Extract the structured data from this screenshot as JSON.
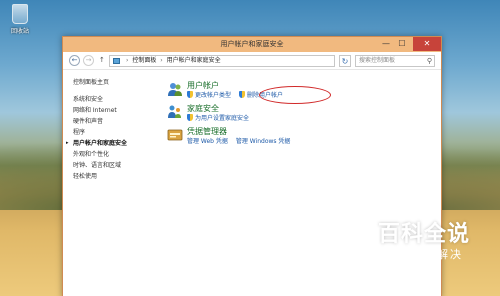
{
  "desktop": {
    "recycle_bin_label": "回收站"
  },
  "window": {
    "title": "用户帐户和家庭安全",
    "controls": {
      "minimize": "—",
      "maximize": "☐",
      "close": "✕"
    }
  },
  "address_bar": {
    "breadcrumb": [
      "控制面板",
      "用户帐户和家庭安全"
    ],
    "separator": "›",
    "search_placeholder": "搜索控制面板"
  },
  "sidebar": {
    "items": [
      {
        "label": "控制面板主页"
      },
      {
        "label": "系统和安全"
      },
      {
        "label": "网络和 Internet"
      },
      {
        "label": "硬件和声音"
      },
      {
        "label": "程序"
      },
      {
        "label": "用户帐户和家庭安全"
      },
      {
        "label": "外观和个性化"
      },
      {
        "label": "时钟、语言和区域"
      },
      {
        "label": "轻松使用"
      }
    ]
  },
  "sections": [
    {
      "title": "用户帐户",
      "links": [
        "更改帐户类型",
        "删除用户帐户"
      ]
    },
    {
      "title": "家庭安全",
      "links": [
        "为用户设置家庭安全"
      ]
    },
    {
      "title": "凭据管理器",
      "links": [
        "管理 Web 凭据",
        "管理 Windows 凭据"
      ]
    }
  ],
  "watermark": {
    "main": "百科全说",
    "sub": "助你轻松解决"
  },
  "colors": {
    "titlebar": "#f1b97f",
    "close_button": "#c7433a",
    "section_title": "#1a6f2b",
    "link": "#1e5aa8",
    "highlight_oval": "#d12a2a"
  }
}
